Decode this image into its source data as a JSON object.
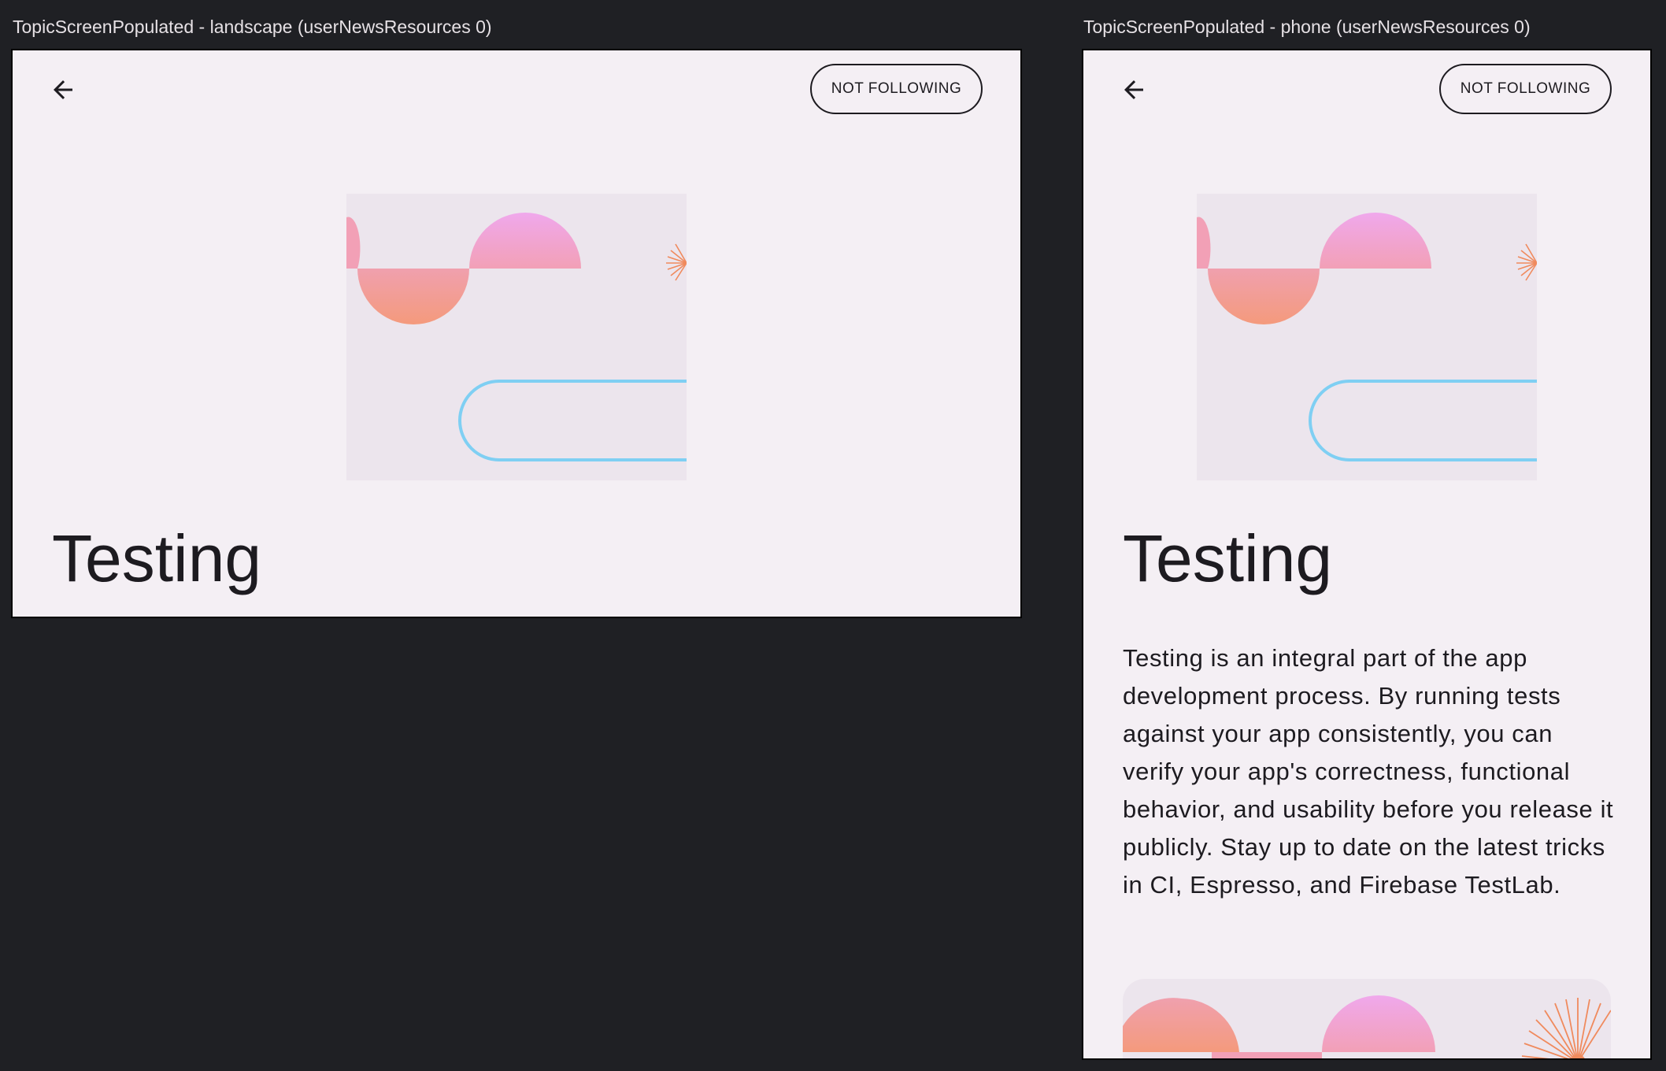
{
  "frames": [
    {
      "label": "TopicScreenPopulated - landscape (userNewsResources 0)",
      "back_icon": "arrow-back-icon",
      "follow_label": "NOT FOLLOWING",
      "topic_name": "Testing"
    },
    {
      "label": "TopicScreenPopulated - phone (userNewsResources 0)",
      "back_icon": "arrow-back-icon",
      "follow_label": "NOT FOLLOWING",
      "topic_name": "Testing",
      "topic_description": "Testing is an integral part of the app development process. By running tests against your app consistently, you can verify your app's correctness, functional behavior, and usability before you release it publicly. Stay up to date on the latest tricks in CI, Espresso, and Firebase TestLab."
    }
  ],
  "colors": {
    "background": "#1f2024",
    "surface": "#f4eff4",
    "hero_bg": "#ece5ed",
    "on_surface": "#1d1b20",
    "pink_top": "#f0a8ec",
    "salmon": "#f39a82",
    "blue_outline": "#7fcff3",
    "orange_rays": "#f08a5d"
  }
}
